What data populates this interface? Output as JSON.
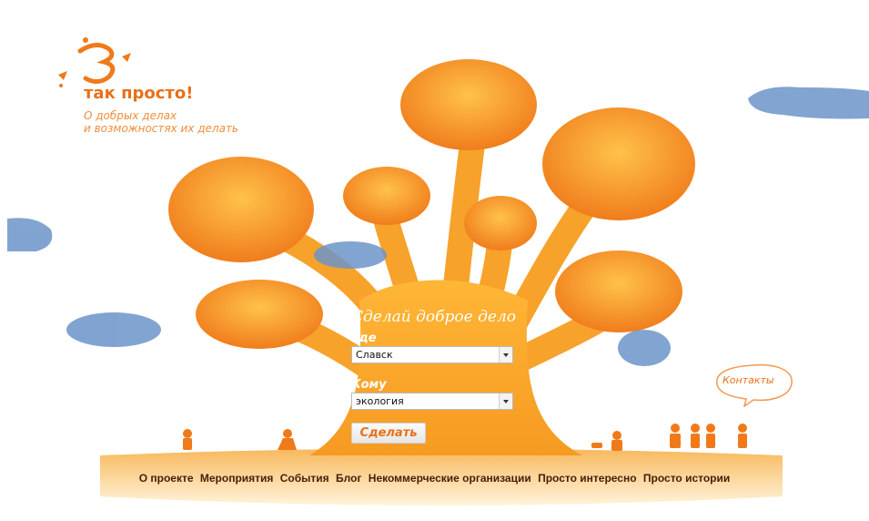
{
  "logo": {
    "title": "так просто!",
    "tagline_line1": "О добрых делах",
    "tagline_line2": "и возможностях их делать"
  },
  "form": {
    "title": "Сделай доброе дело",
    "where_label": "Где",
    "where_value": "Славск",
    "whom_label": "Кому",
    "whom_value": "экология",
    "submit_label": "Сделать"
  },
  "contacts": {
    "label": "Контакты"
  },
  "nav": {
    "items": [
      "О проекте",
      "Мероприятия",
      "События",
      "Блог",
      "Некоммерческие организации",
      "Просто интересно",
      "Просто истории"
    ]
  },
  "colors": {
    "accent": "#e8701a",
    "tree_light": "#ffb02e",
    "tree_dark": "#f07a1a",
    "cloud": "#6c94c9",
    "nav_text": "#4a1c08"
  }
}
